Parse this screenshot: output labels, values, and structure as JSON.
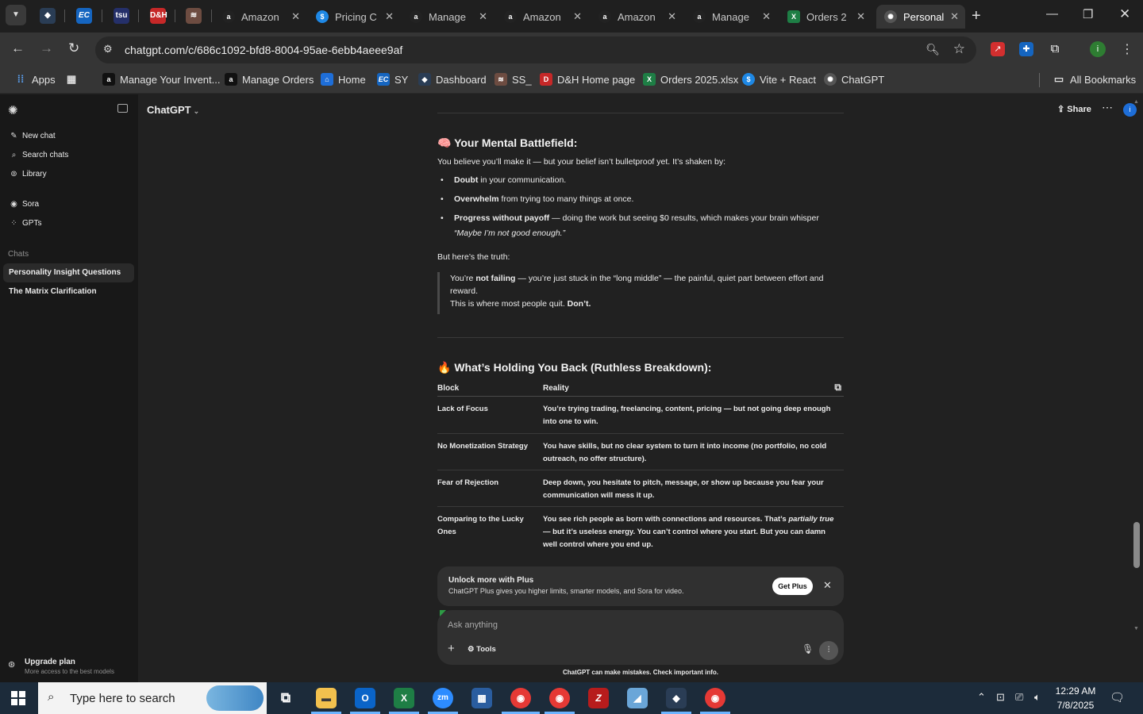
{
  "browser": {
    "tabs": [
      {
        "title": "Amazon",
        "icon": "amazon-icon",
        "color": "#ffffff"
      },
      {
        "title": "Pricing C",
        "icon": "dollar-icon",
        "color": "#1e88e5"
      },
      {
        "title": "Manage",
        "icon": "amazon-icon",
        "color": "#ffffff"
      },
      {
        "title": "Amazon",
        "icon": "amazon-icon",
        "color": "#ffffff"
      },
      {
        "title": "Amazon",
        "icon": "amazon-icon",
        "color": "#ffffff"
      },
      {
        "title": "Manage",
        "icon": "amazon-icon",
        "color": "#ffffff"
      },
      {
        "title": "Orders 2",
        "icon": "excel-icon",
        "color": "#1e7e45"
      },
      {
        "title": "Personali",
        "icon": "chatgpt-icon",
        "color": "#dddddd"
      }
    ],
    "url": "chatgpt.com/c/686c1092-bfd8-8004-95ae-6ebb4aeee9af",
    "profile_initial": "i",
    "bookmarks": [
      {
        "label": "Apps",
        "icon": "apps-grid-icon"
      },
      {
        "label": "",
        "icon": "tab-groups-icon"
      },
      {
        "label": "Manage Your Invent...",
        "icon": "amazon-icon"
      },
      {
        "label": "Manage Orders",
        "icon": "amazon-icon"
      },
      {
        "label": "Home",
        "icon": "home-icon"
      },
      {
        "label": "SY",
        "icon": "ec-icon"
      },
      {
        "label": "Dashboard",
        "icon": "dashboard-icon"
      },
      {
        "label": "SS_",
        "icon": "ss-icon"
      },
      {
        "label": "D&H Home page",
        "icon": "dh-icon"
      },
      {
        "label": "Orders 2025.xlsx",
        "icon": "excel-icon"
      },
      {
        "label": "Vite + React",
        "icon": "dollar-icon"
      },
      {
        "label": "ChatGPT",
        "icon": "chatgpt-icon"
      }
    ],
    "all_bookmarks": "All Bookmarks"
  },
  "sidebar": {
    "nav": [
      {
        "label": "New chat",
        "icon": "new-chat-icon"
      },
      {
        "label": "Search chats",
        "icon": "search-icon"
      },
      {
        "label": "Library",
        "icon": "library-icon"
      }
    ],
    "apps": [
      {
        "label": "Sora",
        "icon": "sora-icon"
      },
      {
        "label": "GPTs",
        "icon": "gpts-icon"
      }
    ],
    "chats_header": "Chats",
    "chats": [
      "Personality Insight Questions",
      "The Matrix Clarification"
    ],
    "upgrade_title": "Upgrade plan",
    "upgrade_sub": "More access to the best models"
  },
  "header": {
    "model": "ChatGPT",
    "share": "Share",
    "avatar_initial": "i"
  },
  "content": {
    "section1_emoji": "🧠",
    "section1_title": "Your Mental Battlefield:",
    "intro": "You believe you’ll make it — but your belief isn’t bulletproof yet. It’s shaken by:",
    "bullets": [
      {
        "strong": "Doubt",
        "rest": " in your communication."
      },
      {
        "strong": "Overwhelm",
        "rest": " from trying too many things at once."
      },
      {
        "strong": "Progress without payoff",
        "rest": " — doing the work but seeing $0 results, which makes your brain whisper",
        "em": "“Maybe I’m not good enough.”"
      }
    ],
    "truth": "But here’s the truth:",
    "quote_pre": "You’re ",
    "quote_strong": "not failing",
    "quote_post": " — you’re just stuck in the “long middle” — the painful, quiet part between effort and reward.",
    "quote_line2": "This is where most people quit. ",
    "quote_dont": "Don’t.",
    "section2_emoji": "🔥",
    "section2_title": "What’s Holding You Back (Ruthless Breakdown):",
    "table_headers": [
      "Block",
      "Reality"
    ],
    "table_rows": [
      {
        "block": "Lack of Focus",
        "reality": "You’re trying trading, freelancing, content, pricing — but not going deep enough into one to win."
      },
      {
        "block": "No Monetization Strategy",
        "reality": "You have skills, but no clear system to turn it into income (no portfolio, no cold outreach, no offer structure)."
      },
      {
        "block": "Fear of Rejection",
        "reality": "Deep down, you hesitate to pitch, message, or show up because you fear your communication will mess it up."
      },
      {
        "block": "Comparing to the Lucky Ones",
        "reality_pre": "You see rich people as born with connections and resources. That’s ",
        "reality_em": "partially true",
        "reality_post": " — but it’s useless energy. You can’t control where you start. But you can damn well control where you end up."
      }
    ]
  },
  "plus_banner": {
    "title": "Unlock more with Plus",
    "subtitle": "ChatGPT Plus gives you higher limits, smarter models, and Sora for video.",
    "button": "Get Plus"
  },
  "composer": {
    "placeholder": "Ask anything",
    "tools": "Tools"
  },
  "disclaimer": "ChatGPT can make mistakes. Check important info.",
  "taskbar": {
    "search_placeholder": "Type here to search",
    "time": "12:29 AM",
    "date": "7/8/2025"
  }
}
